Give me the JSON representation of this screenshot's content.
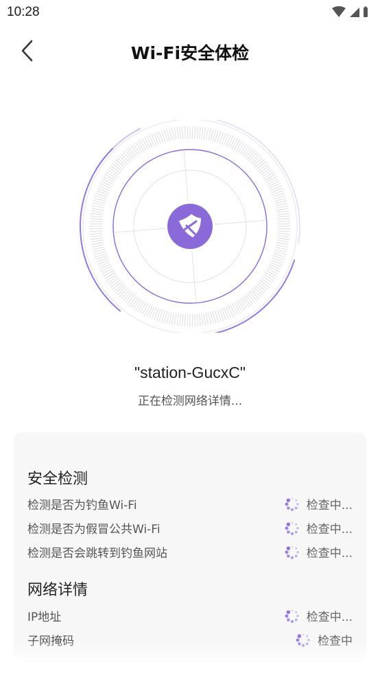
{
  "status_bar": {
    "time": "10:28"
  },
  "header": {
    "title": "Wi-Fi安全体检"
  },
  "scan": {
    "network_name": "\"station-GucxC\"",
    "status": "正在检测网络详情..."
  },
  "colors": {
    "accent": "#8a6ad9",
    "card_bg": "#f7f7f8"
  },
  "security_section": {
    "title": "安全检测",
    "items": [
      {
        "label": "检测是否为钓鱼Wi-Fi",
        "status": "检查中..."
      },
      {
        "label": "检测是否为假冒公共Wi-Fi",
        "status": "检查中..."
      },
      {
        "label": "检测是否会跳转到钓鱼网站",
        "status": "检查中..."
      }
    ]
  },
  "network_section": {
    "title": "网络详情",
    "items": [
      {
        "label": "IP地址",
        "status": "检查中..."
      },
      {
        "label": "子网掩码",
        "status": "检查中"
      }
    ]
  }
}
